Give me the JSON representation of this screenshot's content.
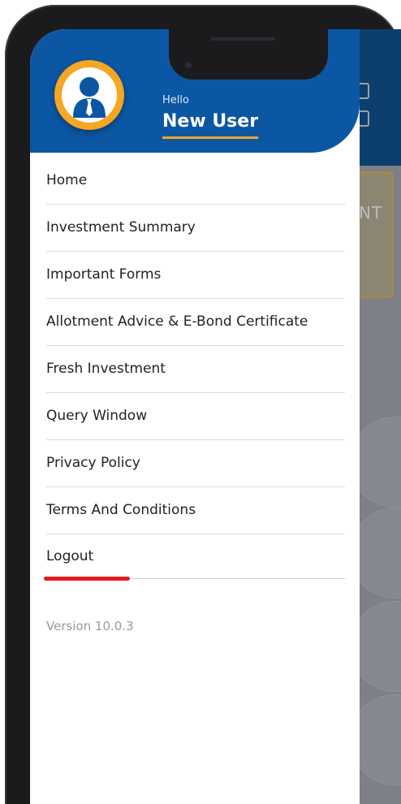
{
  "header": {
    "greeting": "Hello",
    "user_name": "New User"
  },
  "menu": {
    "items": [
      {
        "label": "Home"
      },
      {
        "label": "Investment Summary"
      },
      {
        "label": "Important Forms"
      },
      {
        "label": "Allotment Advice & E-Bond Certificate"
      },
      {
        "label": "Fresh Investment"
      },
      {
        "label": "Query Window"
      },
      {
        "label": "Privacy Policy"
      },
      {
        "label": "Terms And Conditions"
      },
      {
        "label": "Logout"
      }
    ]
  },
  "footer": {
    "version": "Version 10.0.3"
  },
  "background": {
    "card_text": "NT"
  },
  "colors": {
    "header_blue": "#0b57a4",
    "accent_orange": "#f5a623",
    "highlight_red": "#e11b22"
  },
  "icons": {
    "avatar": "user-avatar-icon"
  }
}
